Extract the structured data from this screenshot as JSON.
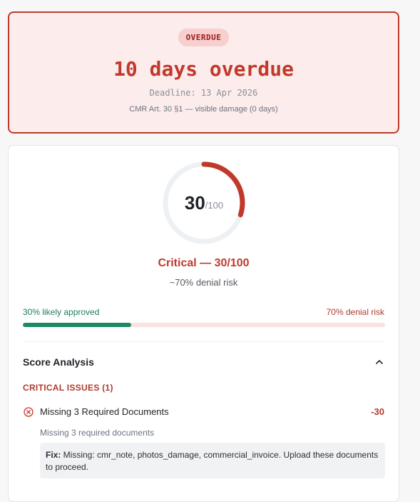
{
  "overdue": {
    "badge": "OVERDUE",
    "title": "10 days overdue",
    "deadline": "Deadline: 13 Apr 2026",
    "rule": "CMR Art. 30 §1 — visible damage (0 days)"
  },
  "score": {
    "value": "30",
    "max": "/100",
    "fraction": 0.3,
    "headline": "Critical — 30/100",
    "risk": "~70% denial risk",
    "approved_label": "30% likely approved",
    "denial_label": "70% denial risk",
    "approved_fraction": 0.3,
    "accent_color": "#c0392b",
    "approved_color": "#1e8a64"
  },
  "analysis": {
    "title": "Score Analysis",
    "section": "CRITICAL ISSUES (1)",
    "issue": {
      "title": "Missing 3 Required Documents",
      "points": "-30",
      "description": "Missing 3 required documents",
      "fix_label": "Fix:",
      "fix_text": " Missing: cmr_note, photos_damage, commercial_invoice. Upload these documents to proceed."
    }
  }
}
